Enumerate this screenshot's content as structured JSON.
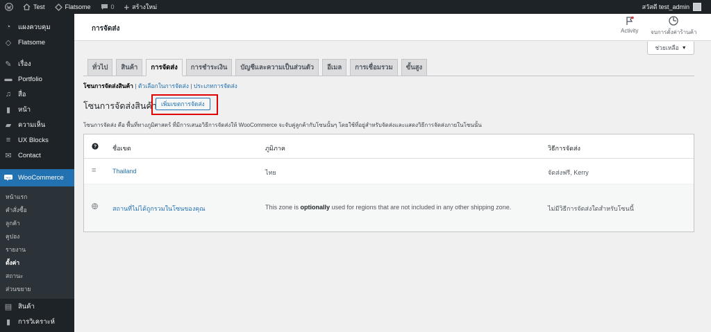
{
  "adminbar": {
    "site_name": "Test",
    "theme_name": "Flatsome",
    "comments_count": "0",
    "new_label": "สร้างใหม่",
    "greeting": "สวัสดี test_admin"
  },
  "sidebar": {
    "items_top": [
      {
        "label": "แผงควบคุม",
        "icon": "dashboard-icon"
      },
      {
        "label": "Flatsome",
        "icon": "flatsome-icon"
      },
      {
        "label": "เรื่อง",
        "icon": "pin-icon"
      },
      {
        "label": "Portfolio",
        "icon": "folder-icon"
      },
      {
        "label": "สื่อ",
        "icon": "media-icon"
      },
      {
        "label": "หน้า",
        "icon": "page-icon"
      },
      {
        "label": "ความเห็น",
        "icon": "comment-icon"
      },
      {
        "label": "UX Blocks",
        "icon": "blocks-icon"
      },
      {
        "label": "Contact",
        "icon": "mail-icon"
      }
    ],
    "active": {
      "label": "WooCommerce",
      "icon": "woo-icon"
    },
    "submenu": [
      "หน้าแรก",
      "คำสั่งซื้อ",
      "ลูกค้า",
      "คูปอง",
      "รายงาน",
      "ตั้งค่า",
      "สถานะ",
      "ส่วนขยาย"
    ],
    "items_bottom": [
      {
        "label": "สินค้า",
        "icon": "product-icon"
      },
      {
        "label": "การวิเคราะห์",
        "icon": "analytics-icon"
      }
    ]
  },
  "header": {
    "title": "การจัดส่ง",
    "activity_label": "Activity",
    "setup_label": "จบการตั้งค่าร้านค้า",
    "help_label": "ช่วยเหลือ"
  },
  "tabs": [
    "ทั่วไป",
    "สินค้า",
    "การจัดส่ง",
    "การชำระเงิน",
    "บัญชีและความเป็นส่วนตัว",
    "อีเมล",
    "การเชื่อมรวม",
    "ขั้นสูง"
  ],
  "subsubsub": {
    "current": "โซนการจัดส่งสินค้า",
    "link1": "ตัวเลือกในการจัดส่ง",
    "link2": "ประเภทการจัดส่ง",
    "sep": "|"
  },
  "section": {
    "heading": "โซนการจัดส่งสินค้า",
    "add_button": "เพิ่มเขตการจัดส่ง",
    "description": "โซนการจัดส่ง คือ พื้นที่ทางภูมิศาสตร์ ที่มีการเสนอวิธีการจัดส่งให้ WooCommerce จะจับคู่ลูกค้ากับโซนนั้นๆ โดยใช้ที่อยู่สำหรับจัดส่งและแสดงวิธีการจัดส่งภายในโซนนั้น"
  },
  "table": {
    "headers": {
      "name": "ชื่อเขต",
      "region": "ภูมิภาค",
      "methods": "วิธีการจัดส่ง"
    },
    "zone": {
      "name": "Thailand",
      "region": "ไทย",
      "methods": "จัดส่งฟรี, Kerry"
    },
    "rest": {
      "name": "สถานที่ไม่ได้ถูกรวมในโซนของคุณ",
      "region_pre": "This zone is ",
      "region_bold": "optionally",
      "region_post": " used for regions that are not included in any other shipping zone.",
      "methods": "ไม่มีวิธีการจัดส่งใดสำหรับโซนนี้"
    }
  },
  "colors": {
    "accent": "#2271b1",
    "highlight": "#e10000",
    "admin_dark": "#1d2327"
  }
}
